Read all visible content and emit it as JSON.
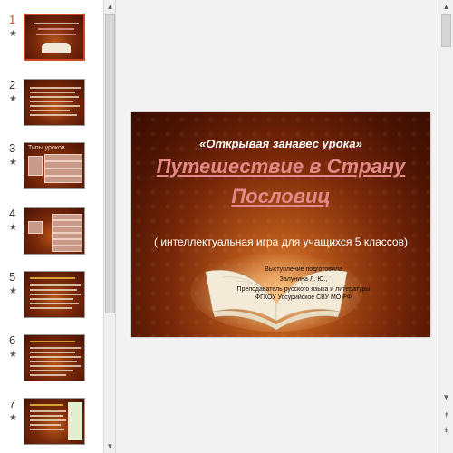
{
  "thumbnails": [
    {
      "number": "1",
      "star": "★"
    },
    {
      "number": "2",
      "star": "★"
    },
    {
      "number": "3",
      "star": "★",
      "title": "Типы уроков"
    },
    {
      "number": "4",
      "star": "★"
    },
    {
      "number": "5",
      "star": "★"
    },
    {
      "number": "6",
      "star": "★"
    },
    {
      "number": "7",
      "star": "★"
    }
  ],
  "slide": {
    "kicker": "«Открывая занавес урока»",
    "title_line1": "Путешествие в Страну",
    "title_line2": "Пословиц",
    "subtitle": "( интеллектуальная игра для учащихся 5 классов)",
    "credit_line1": "Выступление подготовила",
    "credit_line2": "Залунина Л. Ю.,",
    "credit_line3": "Преподаватель русского языка и литературы",
    "credit_line4": "ФГКОУ Уссурийское СВУ МО РФ"
  },
  "scrollbar_icons": {
    "up": "▲",
    "down": "▼",
    "prev": "⯭",
    "next": "⯯"
  }
}
